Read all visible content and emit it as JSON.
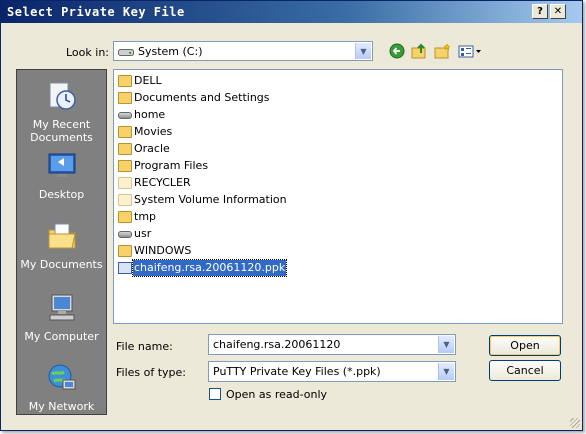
{
  "window": {
    "title": "Select Private Key File",
    "help_glyph": "?",
    "close_glyph": "✕"
  },
  "lookin": {
    "label": "Look in:",
    "value": "System (C:)",
    "drop_glyph": "▼"
  },
  "toolbar": {
    "back_icon": "back-arrow-icon",
    "up_icon": "up-folder-icon",
    "new_folder_icon": "new-folder-icon",
    "views_icon": "views-menu-icon"
  },
  "places": [
    {
      "label": "My Recent Documents",
      "icon": "recent-documents-icon"
    },
    {
      "label": "Desktop",
      "icon": "desktop-icon"
    },
    {
      "label": "My Documents",
      "icon": "my-documents-icon"
    },
    {
      "label": "My Computer",
      "icon": "my-computer-icon"
    },
    {
      "label": "My Network",
      "icon": "my-network-icon"
    }
  ],
  "files": [
    {
      "name": "DELL",
      "type": "folder"
    },
    {
      "name": "Documents and Settings",
      "type": "folder"
    },
    {
      "name": "home",
      "type": "drive"
    },
    {
      "name": "Movies",
      "type": "folder"
    },
    {
      "name": "Oracle",
      "type": "folder"
    },
    {
      "name": "Program Files",
      "type": "folder"
    },
    {
      "name": "RECYCLER",
      "type": "ghost-folder"
    },
    {
      "name": "System Volume Information",
      "type": "ghost-folder"
    },
    {
      "name": "tmp",
      "type": "folder"
    },
    {
      "name": "usr",
      "type": "drive"
    },
    {
      "name": "WINDOWS",
      "type": "folder"
    },
    {
      "name": "chaifeng.rsa.20061120.ppk",
      "type": "ppk",
      "selected": true
    }
  ],
  "filename": {
    "label": "File name:",
    "value": "chaifeng.rsa.20061120"
  },
  "filetype": {
    "label": "Files of type:",
    "value": "PuTTY Private Key Files (*.ppk)"
  },
  "readonly": {
    "label": "Open as read-only",
    "checked": false
  },
  "buttons": {
    "open": "Open",
    "cancel": "Cancel"
  },
  "colors": {
    "titlebar": "#0a246a",
    "selection": "#316ac5",
    "dialog_bg": "#ece9d8"
  }
}
